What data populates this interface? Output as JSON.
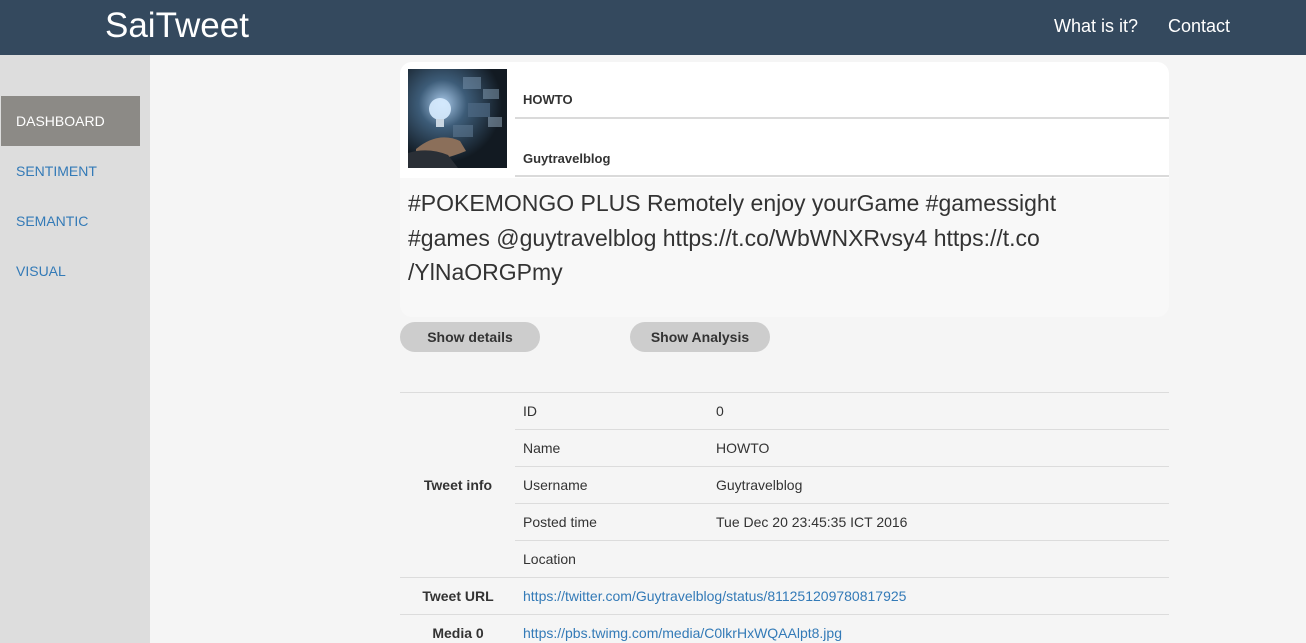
{
  "navbar": {
    "brand": "SaiTweet",
    "links": [
      "What is it?",
      "Contact"
    ]
  },
  "sidebar": {
    "items": [
      {
        "label": "DASHBOARD",
        "active": true
      },
      {
        "label": "SENTIMENT",
        "active": false
      },
      {
        "label": "SEMANTIC",
        "active": false
      },
      {
        "label": "VISUAL",
        "active": false
      }
    ]
  },
  "tweet": {
    "name": "HOWTO",
    "username": "Guytravelblog",
    "text_lines": [
      "#POKEMONGO PLUS Remotely enjoy yourGame #gamessight",
      "#games @guytravelblog https://t.co/WbWNXRvsy4 https://t.co",
      "/YlNaORGPmy"
    ]
  },
  "buttons": {
    "details": "Show details",
    "analysis": "Show Analysis"
  },
  "info": {
    "tweet_info_label": "Tweet info",
    "rows": [
      {
        "key": "ID",
        "value": "0"
      },
      {
        "key": "Name",
        "value": "HOWTO"
      },
      {
        "key": "Username",
        "value": "Guytravelblog"
      },
      {
        "key": "Posted time",
        "value": "Tue Dec 20 23:45:35 ICT 2016"
      },
      {
        "key": "Location",
        "value": ""
      }
    ],
    "tweet_url_label": "Tweet URL",
    "tweet_url": "https://twitter.com/Guytravelblog/status/811251209780817925",
    "media_label": "Media 0",
    "media_url": "https://pbs.twimg.com/media/C0lkrHxWQAAlpt8.jpg"
  },
  "colors": {
    "navbar": "#34495e",
    "sidebar": "#dddddd",
    "active_item": "#8c8a86",
    "link": "#337ab7",
    "button": "#cdcdcd"
  }
}
